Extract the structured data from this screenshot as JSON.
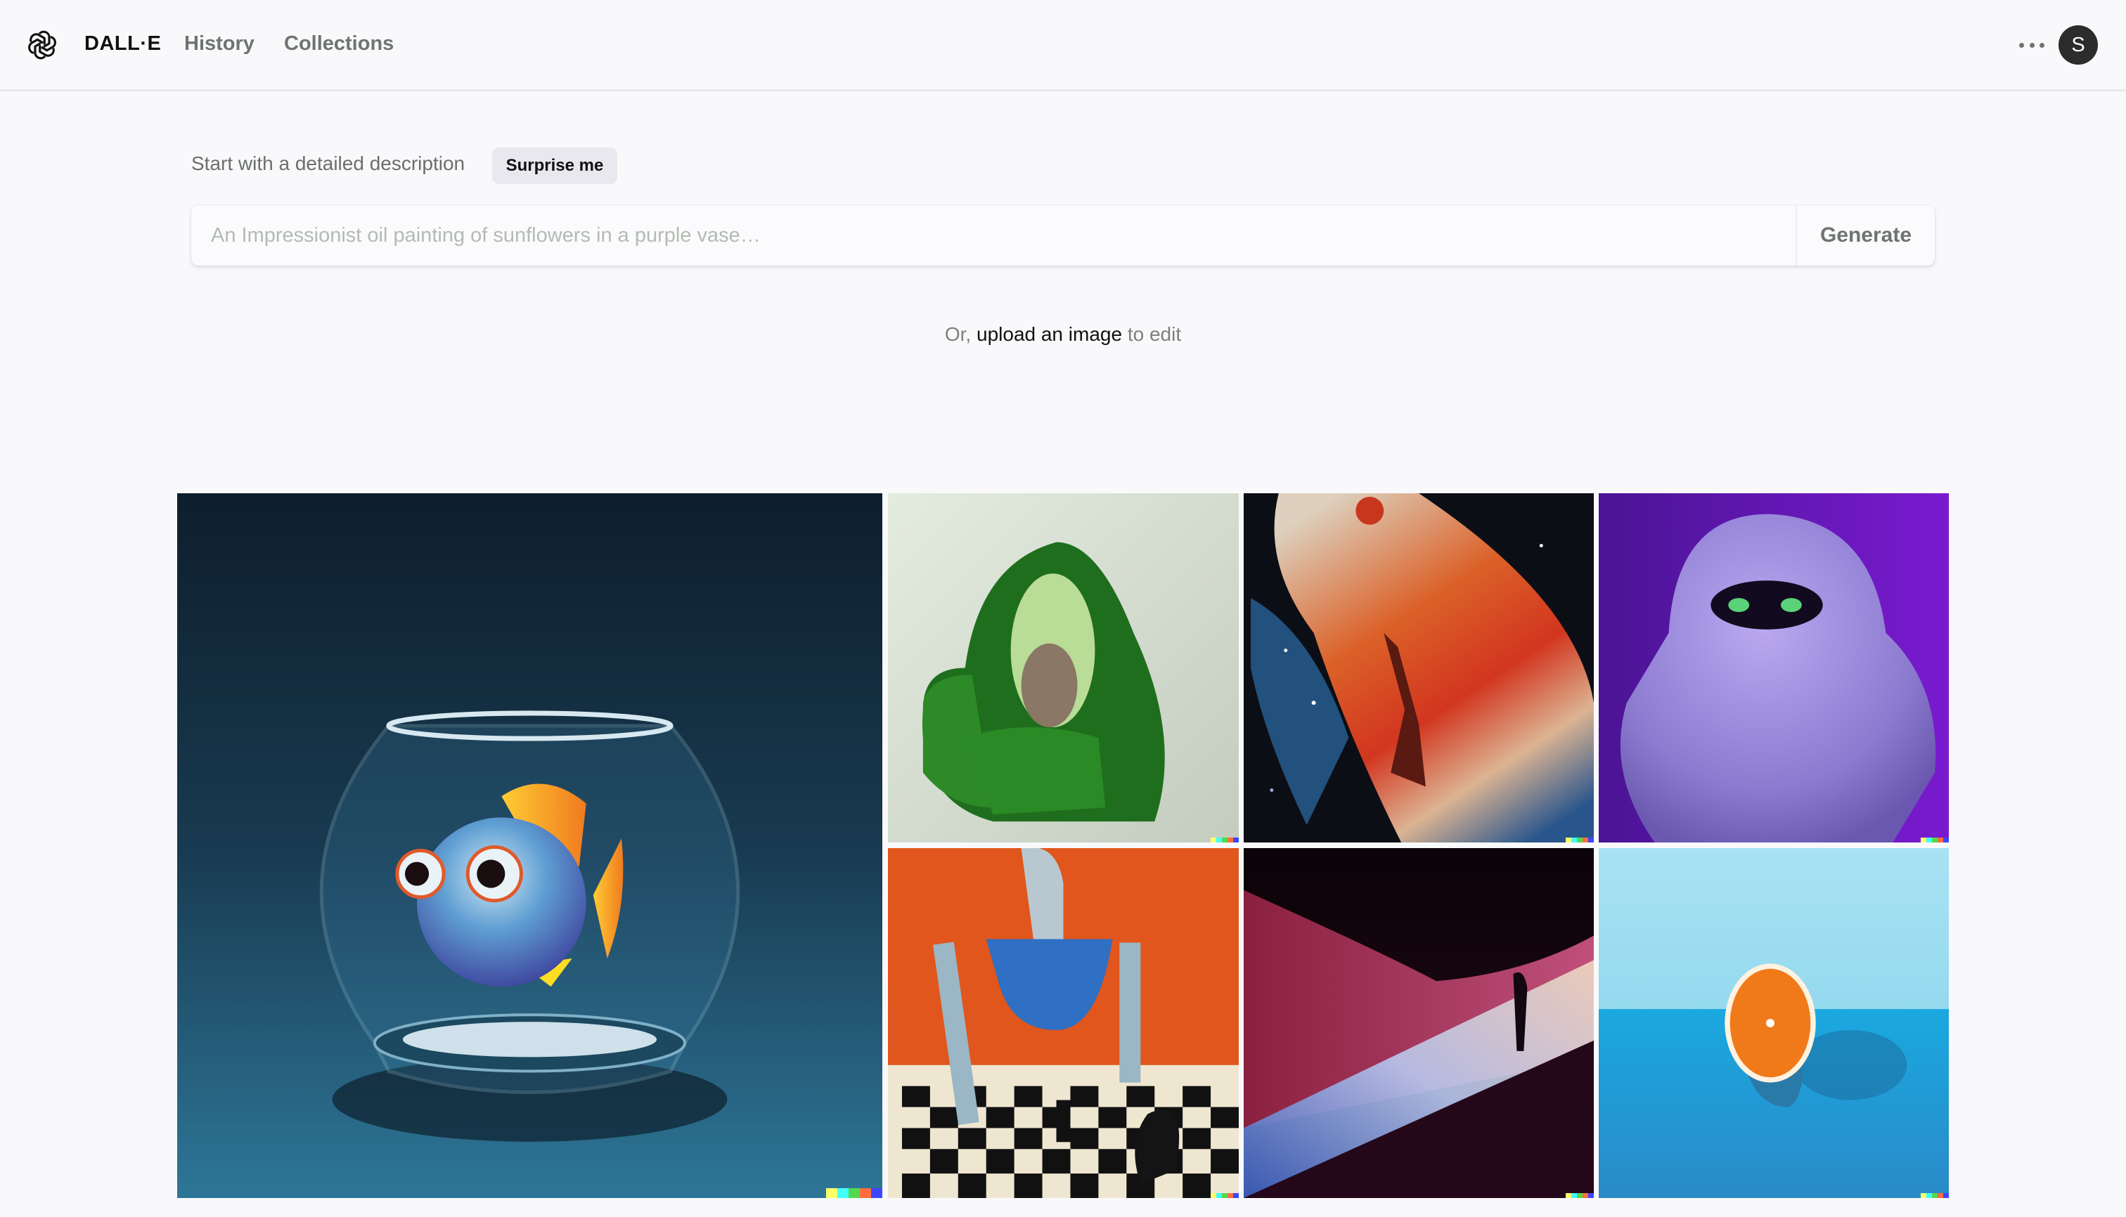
{
  "header": {
    "logo_icon": "openai-logo-icon",
    "brand": "DALL·E",
    "nav": [
      {
        "label": "History"
      },
      {
        "label": "Collections"
      }
    ],
    "more_icon": "ellipsis-icon",
    "avatar_initial": "S"
  },
  "prompt": {
    "label": "Start with a detailed description",
    "surprise_label": "Surprise me",
    "placeholder": "An Impressionist oil painting of sunflowers in a purple vase…",
    "value": "",
    "generate_label": "Generate"
  },
  "upload": {
    "prefix": "Or, ",
    "link": "upload an image",
    "suffix": " to edit"
  },
  "gallery": {
    "watermark_colors": [
      "#ffff66",
      "#42ffff",
      "#51da4c",
      "#ff6e3c",
      "#3c46ff"
    ],
    "images": [
      {
        "subject": "cartoon fish in a glass fishbowl"
      },
      {
        "subject": "avocado-shaped green armchair"
      },
      {
        "subject": "basketball player dunking in cosmic painting"
      },
      {
        "subject": "fluffy purple monster with green eyes"
      },
      {
        "subject": "robot playing chess, oil painting"
      },
      {
        "subject": "silhouetted figure in surreal dunes"
      },
      {
        "subject": "half orange on blue surface"
      }
    ]
  }
}
